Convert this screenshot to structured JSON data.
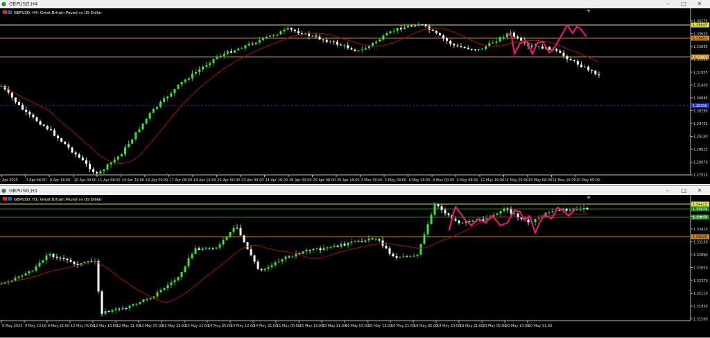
{
  "windows": [
    {
      "title": "GBPUSD,H4",
      "header": "GBPUSD, H4:  Great Britain Pound vs US Dollar",
      "price_labels": [
        "1.34175",
        "1.33620",
        "1.33065",
        "1.32510",
        "1.31955",
        "1.31400",
        "1.30845",
        "1.30290",
        "1.29735",
        "1.29180",
        "1.28625",
        "1.28070",
        "1.27515"
      ],
      "time_labels": [
        "Apr 2025",
        "7 Apr 08:00",
        "8 Apr 16:00",
        "10 Apr 00:00",
        "11 Apr 08:00",
        "14 Apr 16:00",
        "16 Apr 00:00",
        "17 Apr 08:00",
        "18 Apr 16:00",
        "22 Apr 00:00",
        "23 Apr 08:00",
        "24 Apr 16:00",
        "28 Apr 00:00",
        "29 Apr 08:00",
        "30 Apr 16:00",
        "2 May 00:00",
        "5 May 08:00",
        "6 May 16:00",
        "8 May 00:00",
        "9 May 08:00",
        "12 May 16:00",
        "14 May 00:00",
        "15 May 08:00",
        "16 May 16:00",
        "20 May 00:00"
      ],
      "level_tags": [
        "1.33937",
        "1.33451",
        "1.32463",
        "1.30200"
      ]
    },
    {
      "title": "GBPUSD,H1",
      "header": "GBPUSD, H1:  Great Britain Pound vs US Dollar",
      "price_labels": [
        "1.34621",
        "1.33670",
        "1.33410",
        "1.33150",
        "1.32890",
        "1.32630",
        "1.32370",
        "1.32110",
        "1.31850",
        "1.31590"
      ],
      "time_labels": [
        "9 May 2025",
        "9 May 13:00",
        "9 May 21:00",
        "12 May 05:00",
        "12 May 13:00",
        "12 May 21:00",
        "13 May 05:00",
        "13 May 13:00",
        "13 May 21:00",
        "14 May 05:00",
        "14 May 13:00",
        "14 May 21:00",
        "15 May 05:00",
        "15 May 13:00",
        "15 May 21:00",
        "16 May 05:00",
        "16 May 13:00",
        "16 May 21:00",
        "19 May 05:00",
        "19 May 13:00",
        "19 May 21:00",
        "20 May 05:00",
        "20 May 13:00",
        "20 May 21:00"
      ],
      "level_tags": [
        "1.34621",
        "1.33974",
        "1.33670",
        "1.33020"
      ]
    }
  ],
  "icons": {
    "app": "chart-window-icon",
    "minimize": "minimize-icon",
    "maximize": "maximize-icon",
    "close": "close-icon"
  },
  "colors": {
    "bull": "#39e639",
    "bear": "#ffffff",
    "ma": "#b01212",
    "drawing": "#e6187a",
    "level_yellow": "#dede34",
    "level_orange": "#d08a1a",
    "level_blue": "#2233cc",
    "level_green": "#1f8a1f"
  }
}
